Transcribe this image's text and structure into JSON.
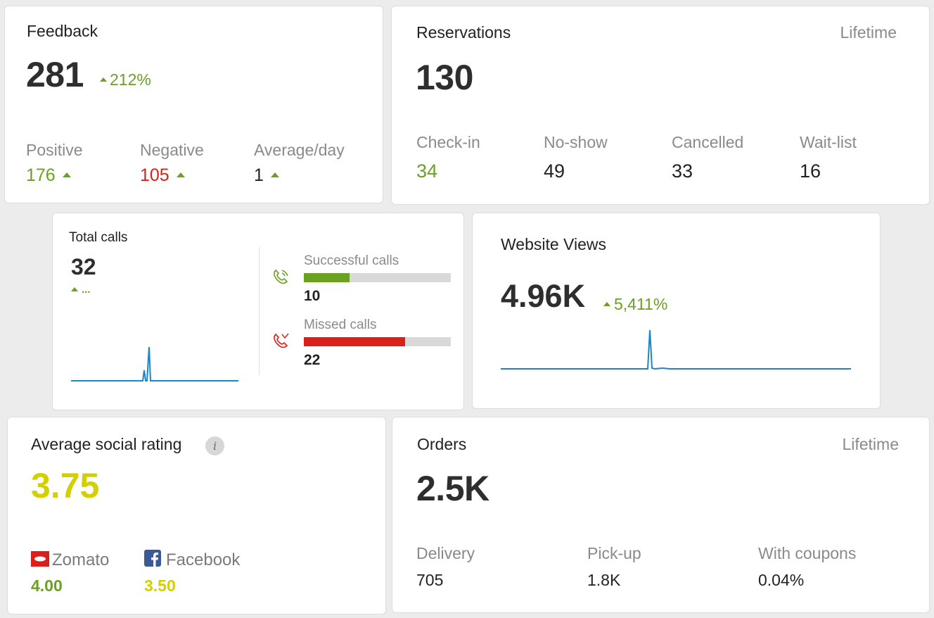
{
  "feedback": {
    "title": "Feedback",
    "total": "281",
    "change": "212%",
    "stats": [
      {
        "label": "Positive",
        "value": "176"
      },
      {
        "label": "Negative",
        "value": "105"
      },
      {
        "label": "Average/day",
        "value": "1"
      }
    ]
  },
  "reservations": {
    "title": "Reservations",
    "period": "Lifetime",
    "total": "130",
    "stats": [
      {
        "label": "Check-in",
        "value": "34"
      },
      {
        "label": "No-show",
        "value": "49"
      },
      {
        "label": "Cancelled",
        "value": "33"
      },
      {
        "label": "Wait-list",
        "value": "16"
      }
    ]
  },
  "calls": {
    "title": "Total calls",
    "total": "32",
    "change": "...",
    "successful": {
      "label": "Successful calls",
      "value": "10",
      "ratio": 0.3125
    },
    "missed": {
      "label": "Missed calls",
      "value": "22",
      "ratio": 0.6875
    }
  },
  "website": {
    "title": "Website Views",
    "total": "4.96K",
    "change": "5,411%"
  },
  "rating": {
    "title": "Average social rating",
    "info_icon": "i",
    "value": "3.75",
    "sources": [
      {
        "name": "Zomato",
        "value": "4.00",
        "icon": "zomato-icon"
      },
      {
        "name": "Facebook",
        "value": "3.50",
        "icon": "facebook-icon"
      }
    ]
  },
  "orders": {
    "title": "Orders",
    "period": "Lifetime",
    "total": "2.5K",
    "stats": [
      {
        "label": "Delivery",
        "value": "705"
      },
      {
        "label": "Pick-up",
        "value": "1.8K"
      },
      {
        "label": "With coupons",
        "value": "0.04%"
      }
    ]
  },
  "colors": {
    "green": "#6aa121",
    "red": "#d9211b",
    "yellow": "#d4d000",
    "sparkline": "#1a86c8"
  }
}
